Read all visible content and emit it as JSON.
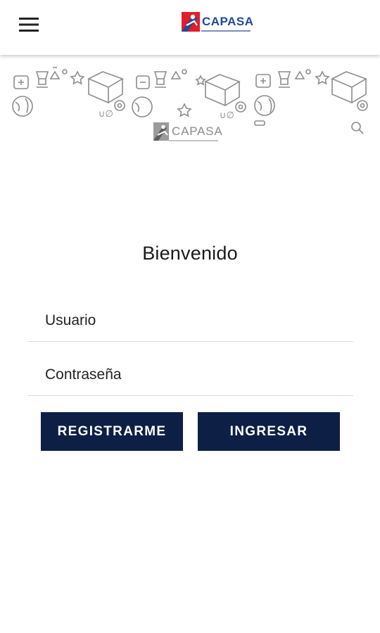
{
  "header": {
    "menu_icon": "hamburger-menu-icon",
    "logo_text": "CAPASA",
    "colors": {
      "logo_red": "#e01f2a",
      "logo_blue": "#1d4aa0",
      "bar_background": "#ffffff"
    }
  },
  "banner": {
    "logo_text": "CAPASA",
    "icons": [
      "flask-icon",
      "book-icon",
      "trophy-icon",
      "globe-icon",
      "star-icon",
      "gear-icon",
      "calculator-icon"
    ]
  },
  "login": {
    "title": "Bienvenido",
    "username_placeholder": "Usuario",
    "password_placeholder": "Contraseña",
    "register_label": "REGISTRARME",
    "login_label": "INGRESAR",
    "colors": {
      "button_background": "#0d1f45",
      "button_text": "#ffffff"
    }
  }
}
